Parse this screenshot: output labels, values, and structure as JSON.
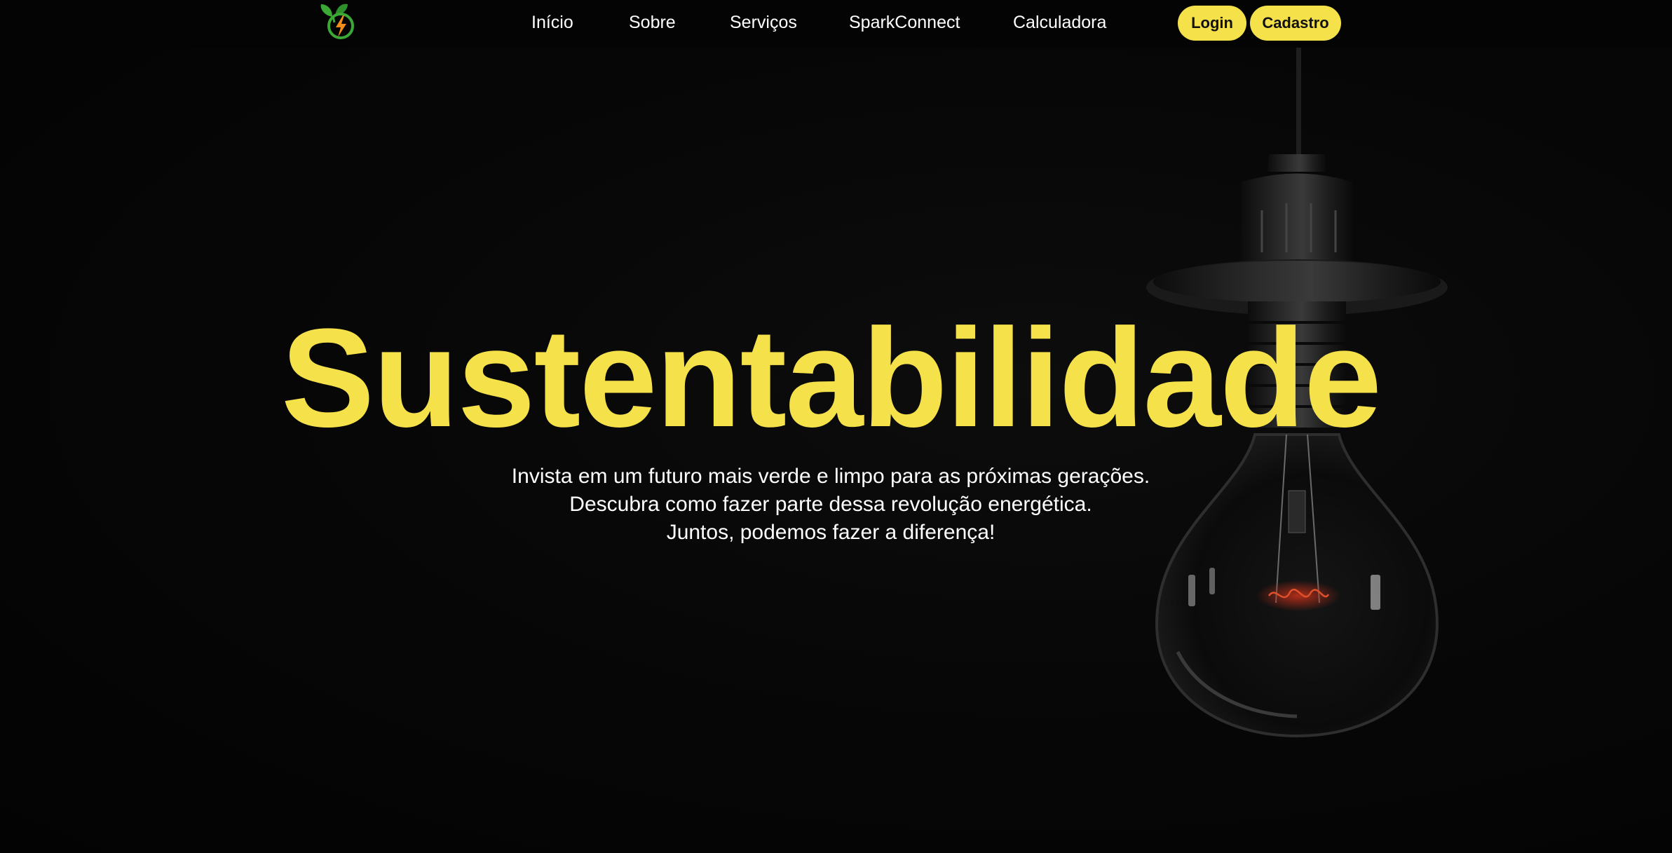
{
  "nav": {
    "logo_icon": "leaf-lightning-logo",
    "links": [
      "Início",
      "Sobre",
      "Serviços",
      "SparkConnect",
      "Calculadora"
    ],
    "login_label": "Login",
    "signup_label": "Cadastro"
  },
  "hero": {
    "title": "Sustentabilidade",
    "lines": [
      "Invista em um futuro mais verde e limpo para as próximas gerações.",
      "Descubra como fazer parte dessa revolução energética.",
      "Juntos, podemos fazer a diferença!"
    ]
  },
  "colors": {
    "accent": "#f5e14a",
    "background": "#050505",
    "text": "#ffffff",
    "logo_green": "#3aa935",
    "logo_orange": "#f28c1b"
  }
}
